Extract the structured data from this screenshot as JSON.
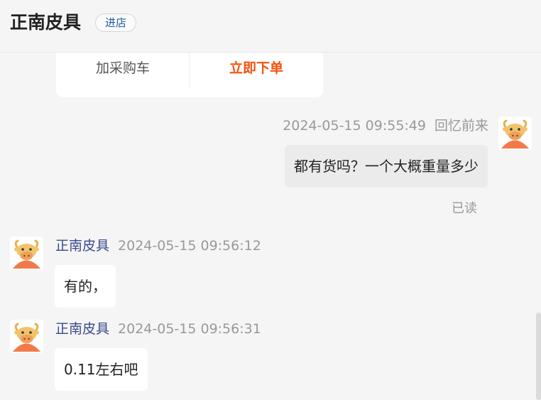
{
  "header": {
    "shop_name": "正南皮具",
    "enter_store_label": "进店"
  },
  "order_card": {
    "add_to_cart_label": "加采购车",
    "buy_now_label": "立即下单"
  },
  "messages": [
    {
      "side": "right",
      "sender": "回忆前来",
      "time": "2024-05-15 09:55:49",
      "text": "都有货吗？一个大概重量多少",
      "status": "已读"
    },
    {
      "side": "left",
      "sender": "正南皮具",
      "time": "2024-05-15 09:56:12",
      "text": "有的，"
    },
    {
      "side": "left",
      "sender": "正南皮具",
      "time": "2024-05-15 09:56:31",
      "text": "0.11左右吧"
    }
  ]
}
